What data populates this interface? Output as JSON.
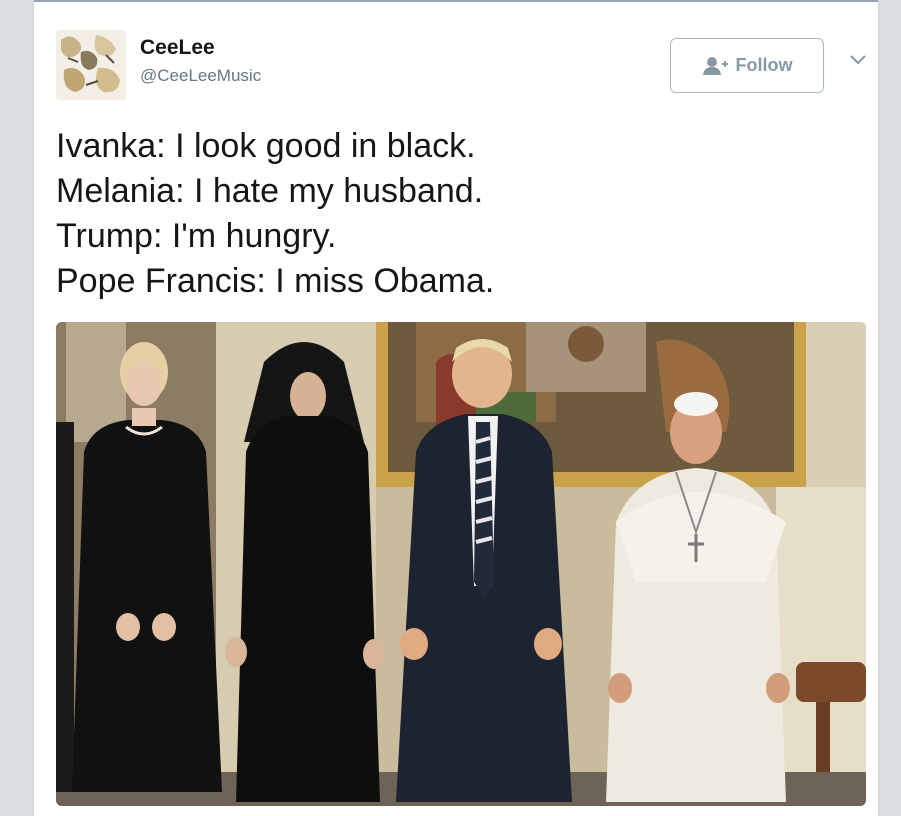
{
  "user": {
    "display_name": "CeeLee",
    "handle": "@CeeLeeMusic"
  },
  "actions": {
    "follow_label": "Follow"
  },
  "icons": {
    "follow": "add-user-icon",
    "menu": "chevron-down-icon"
  },
  "tweet": {
    "lines": [
      "Ivanka: I look good in black.",
      "Melania: I hate my husband.",
      "Trump: I'm hungry.",
      "Pope Francis: I miss Obama."
    ]
  },
  "colors": {
    "follow_text": "#8899a6",
    "text": "#14171a",
    "handle": "#657786"
  }
}
